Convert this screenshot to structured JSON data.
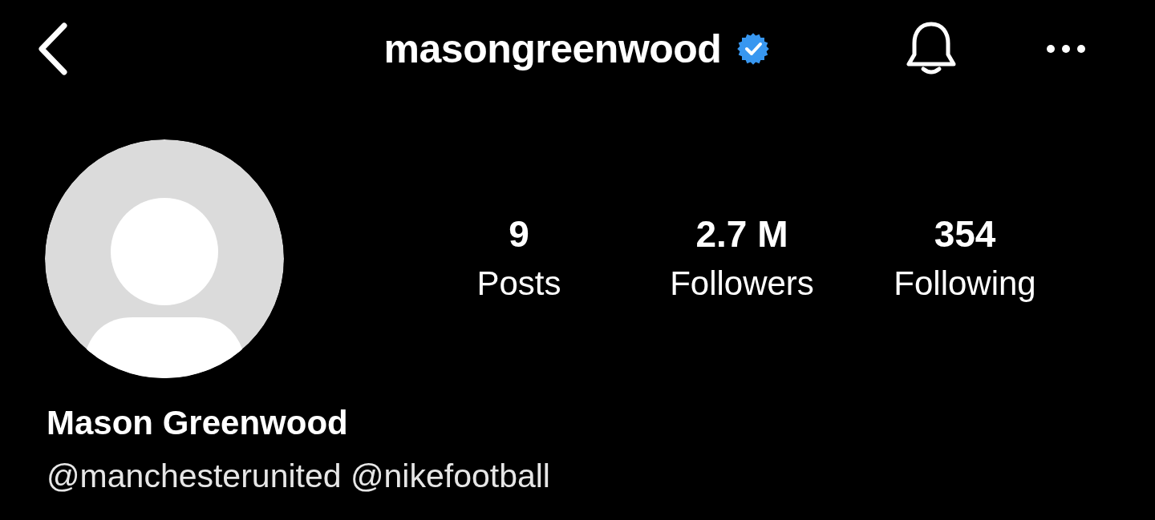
{
  "header": {
    "title": "masongreenwood",
    "verified": true
  },
  "profile": {
    "stats": [
      {
        "value": "9",
        "label": "Posts"
      },
      {
        "value": "2.7 M",
        "label": "Followers"
      },
      {
        "value": "354",
        "label": "Following"
      }
    ],
    "name": "Mason Greenwood",
    "bio": "@manchesterunited @nikefootball"
  }
}
